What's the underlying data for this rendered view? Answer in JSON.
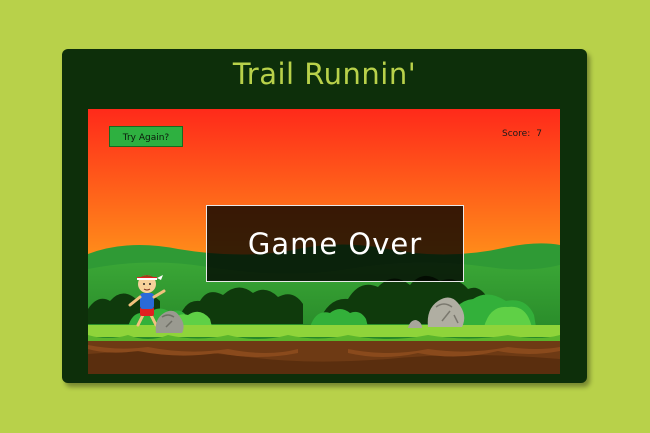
{
  "game": {
    "title": "Trail Runnin'",
    "try_again_label": "Try Again?",
    "score_label": "Score:",
    "score_value": "7",
    "overlay_text": "Game Over"
  },
  "colors": {
    "page_background": "#b8d14a",
    "panel_background": "#0d2f0a",
    "title_color": "#b8d14a",
    "button_color": "#2eb040",
    "sky_top": "#ff2a1a",
    "sky_bottom": "#ffc21a"
  },
  "icons": [
    "runner-character",
    "rock-obstacle",
    "rock-obstacle",
    "small-rock"
  ]
}
